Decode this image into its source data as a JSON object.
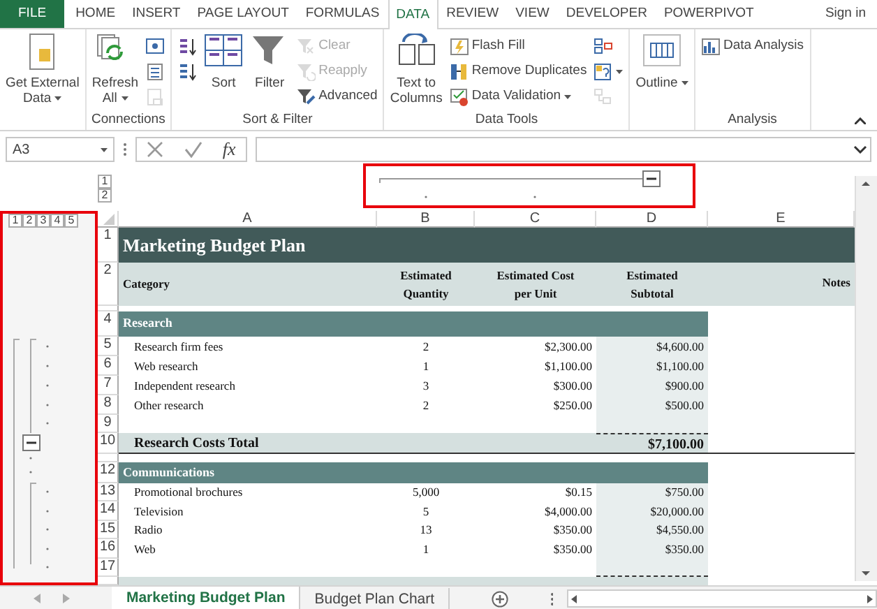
{
  "ribbon_tabs": [
    {
      "label": "FILE",
      "kind": "file",
      "selected": false
    },
    {
      "label": "HOME",
      "kind": "tab",
      "selected": false
    },
    {
      "label": "INSERT",
      "kind": "tab",
      "selected": false
    },
    {
      "label": "PAGE LAYOUT",
      "kind": "tab",
      "selected": false
    },
    {
      "label": "FORMULAS",
      "kind": "tab",
      "selected": false
    },
    {
      "label": "DATA",
      "kind": "tab",
      "selected": true
    },
    {
      "label": "REVIEW",
      "kind": "tab",
      "selected": false
    },
    {
      "label": "VIEW",
      "kind": "tab",
      "selected": false
    },
    {
      "label": "DEVELOPER",
      "kind": "tab",
      "selected": false
    },
    {
      "label": "POWERPIVOT",
      "kind": "tab",
      "selected": false
    }
  ],
  "sign_in": "Sign in",
  "ribbon_groups": [
    {
      "columns": [
        [
          {
            "kind": "large",
            "label": [
              "Get External",
              "Data"
            ],
            "dropdown": true,
            "disabled": false
          }
        ]
      ]
    },
    {
      "title": "Connections",
      "columns": [
        [
          {
            "kind": "large",
            "label": [
              "Refresh",
              "All"
            ],
            "dropdown": true,
            "disabled": false
          }
        ],
        [
          {
            "kind": "small",
            "dropdown": false,
            "disabled": false
          },
          {
            "kind": "small",
            "dropdown": false,
            "disabled": false
          },
          {
            "kind": "small",
            "dropdown": false,
            "disabled": true
          }
        ]
      ]
    },
    {
      "title": "Sort & Filter",
      "columns": [
        [
          {
            "kind": "small",
            "dropdown": false,
            "disabled": false
          },
          {
            "kind": "small",
            "dropdown": false,
            "disabled": false
          }
        ],
        [
          {
            "kind": "large",
            "label": [
              "Sort"
            ],
            "dropdown": false,
            "disabled": false
          }
        ],
        [
          {
            "kind": "large",
            "label": [
              "Filter"
            ],
            "dropdown": false,
            "disabled": false
          }
        ],
        [
          {
            "kind": "small",
            "label": [
              "Clear"
            ],
            "dropdown": false,
            "disabled": true
          },
          {
            "kind": "small",
            "label": [
              "Reapply"
            ],
            "dropdown": false,
            "disabled": true
          },
          {
            "kind": "small",
            "label": [
              "Advanced"
            ],
            "dropdown": false,
            "disabled": false
          }
        ]
      ]
    },
    {
      "title": "Data Tools",
      "columns": [
        [
          {
            "kind": "large",
            "label": [
              "Text to",
              "Columns"
            ],
            "dropdown": false,
            "disabled": false
          }
        ],
        [
          {
            "kind": "small",
            "label": [
              "Flash Fill"
            ],
            "dropdown": false,
            "disabled": false
          },
          {
            "kind": "small",
            "label": [
              "Remove Duplicates"
            ],
            "dropdown": false,
            "disabled": false
          },
          {
            "kind": "small",
            "label": [
              "Data Validation"
            ],
            "dropdown": true,
            "disabled": false
          }
        ],
        [
          {
            "kind": "small",
            "dropdown": false,
            "disabled": false
          },
          {
            "kind": "small",
            "dropdown": true,
            "disabled": false
          },
          {
            "kind": "small",
            "dropdown": false,
            "disabled": true
          }
        ]
      ]
    },
    {
      "columns": [
        [
          {
            "kind": "large",
            "label": [
              "Outline"
            ],
            "dropdown": true,
            "disabled": false
          }
        ]
      ]
    },
    {
      "title": "Analysis",
      "columns": [
        [
          {
            "kind": "small",
            "label": [
              "Data Analysis"
            ],
            "dropdown": false,
            "disabled": false
          }
        ]
      ]
    }
  ],
  "formula_bar": {
    "name_box": "A3",
    "function_label": "fx"
  },
  "column_outline": {
    "levels": [
      "1",
      "2"
    ]
  },
  "row_outline": {
    "levels": [
      "1",
      "2",
      "3",
      "4",
      "5"
    ]
  },
  "columns": [
    "A",
    "B",
    "C",
    "D",
    "E"
  ],
  "rows": [
    {
      "number": "1",
      "kind": "title",
      "cells": [
        "Marketing Budget Plan"
      ]
    },
    {
      "number": "2",
      "kind": "header",
      "cells": [
        "Category",
        "Estimated Quantity",
        "Estimated Cost per Unit",
        "Estimated Subtotal",
        "Notes"
      ]
    },
    {
      "kind": "spacer"
    },
    {
      "number": "4",
      "kind": "section",
      "cells": [
        "Research"
      ]
    },
    {
      "number": "5",
      "kind": "item",
      "cells": [
        "Research firm fees",
        "2",
        "$2,300.00",
        "$4,600.00"
      ]
    },
    {
      "number": "6",
      "kind": "item",
      "cells": [
        "Web research",
        "1",
        "$1,100.00",
        "$1,100.00"
      ]
    },
    {
      "number": "7",
      "kind": "item",
      "cells": [
        "Independent research",
        "3",
        "$300.00",
        "$900.00"
      ]
    },
    {
      "number": "8",
      "kind": "item",
      "cells": [
        "Other research",
        "2",
        "$250.00",
        "$500.00"
      ]
    },
    {
      "number": "9",
      "kind": "item",
      "cells": []
    },
    {
      "number": "10",
      "kind": "total",
      "cells": [
        "Research Costs Total",
        "$7,100.00"
      ]
    },
    {
      "kind": "spacer"
    },
    {
      "number": "12",
      "kind": "section",
      "cells": [
        "Communications"
      ]
    },
    {
      "number": "13",
      "kind": "item",
      "cells": [
        "Promotional brochures",
        "5,000",
        "$0.15",
        "$750.00"
      ]
    },
    {
      "number": "14",
      "kind": "item",
      "cells": [
        "Television",
        "5",
        "$4,000.00",
        "$20,000.00"
      ]
    },
    {
      "number": "15",
      "kind": "item",
      "cells": [
        "Radio",
        "13",
        "$350.00",
        "$4,550.00"
      ]
    },
    {
      "number": "16",
      "kind": "item",
      "cells": [
        "Web",
        "1",
        "$350.00",
        "$350.00"
      ]
    },
    {
      "number": "17",
      "kind": "item",
      "cells": []
    }
  ],
  "sheet_tabs": [
    {
      "label": "Marketing Budget Plan",
      "selected": true
    },
    {
      "label": "Budget Plan Chart",
      "selected": false
    }
  ]
}
